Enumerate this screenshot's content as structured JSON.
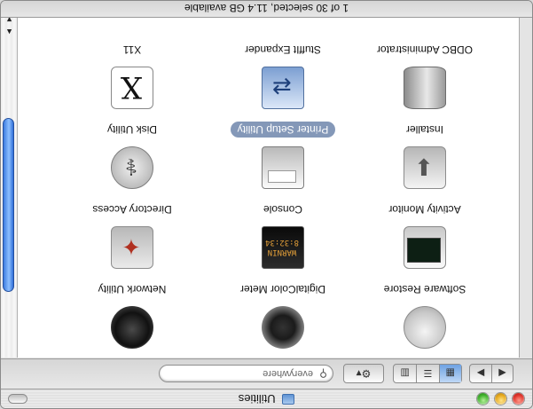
{
  "window": {
    "title": "Utilities",
    "status": "1 of 30 selected, 11.4 GB available"
  },
  "toolbar": {
    "back_icon": "◀",
    "forward_icon": "▶",
    "view_icon_mode": "▦",
    "view_list_mode": "☰",
    "view_column_mode": "▥",
    "action_label": "⚙▾",
    "search_placeholder": "everywhere",
    "search_icon": "⚲"
  },
  "items": [
    {
      "label": "Software Restore",
      "icon": "software-restore-icon"
    },
    {
      "label": "DigitalColor Meter",
      "icon": "digitalcolor-meter-icon"
    },
    {
      "label": "Network Utility",
      "icon": "network-utility-icon"
    },
    {
      "label": "Activity Monitor",
      "icon": "activity-monitor-icon"
    },
    {
      "label": "Console",
      "icon": "console-icon",
      "glyph": "WARNIN\n8:32:34"
    },
    {
      "label": "Directory Access",
      "icon": "directory-access-icon",
      "glyph": "✦"
    },
    {
      "label": "Installer",
      "icon": "installer-icon",
      "glyph": "⬇"
    },
    {
      "label": "Printer Setup Utility",
      "icon": "printer-setup-icon",
      "selected": true
    },
    {
      "label": "Disk Utility",
      "icon": "disk-utility-icon",
      "glyph": "⚕"
    },
    {
      "label": "ODBC Administrator",
      "icon": "odbc-administrator-icon"
    },
    {
      "label": "StuffIt Expander",
      "icon": "stuffit-expander-icon",
      "glyph": "⇄"
    },
    {
      "label": "X11",
      "icon": "x11-icon",
      "glyph": "X"
    }
  ],
  "colors": {
    "selection": "#8498b8",
    "scroll_thumb": "#3b7be0"
  }
}
